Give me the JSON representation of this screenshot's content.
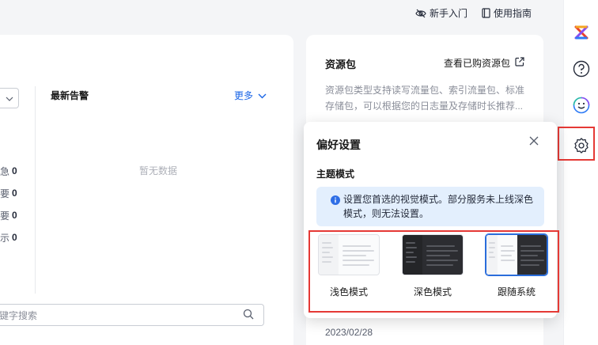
{
  "header": {
    "guide_label": "新手入门",
    "manual_label": "使用指南"
  },
  "left_panel": {
    "alarm_title": "最新告警",
    "more_label": "更多",
    "empty_text": "暂无数据",
    "levels": [
      {
        "label": "急",
        "count": "0"
      },
      {
        "label": "要",
        "count": "0"
      },
      {
        "label": "要",
        "count": "0"
      },
      {
        "label": "示",
        "count": "0"
      }
    ],
    "search_placeholder": "键字搜索"
  },
  "right_panel": {
    "title": "资源包",
    "link_label": "查看已购资源包",
    "description": "资源包类型支持读写流量包、索引流量包、标准存储包，可以根据您的日志量及存储时长推荐...",
    "date": "2023/02/28"
  },
  "popup": {
    "title": "偏好设置",
    "section_title": "主题模式",
    "info_text": "设置您首选的视觉模式。部分服务未上线深色模式，则无法设置。",
    "themes": [
      {
        "label": "浅色模式",
        "variant": "light"
      },
      {
        "label": "深色模式",
        "variant": "dark"
      },
      {
        "label": "跟随系统",
        "variant": "system",
        "selected": true
      }
    ]
  },
  "sidebar": {
    "icons": [
      "brand-logo-icon",
      "help-icon",
      "smile-icon",
      "gear-icon"
    ],
    "active": "gear-icon"
  },
  "colors": {
    "accent": "#1a65e6",
    "highlight": "#e53935",
    "info_bg": "#e3effd"
  }
}
